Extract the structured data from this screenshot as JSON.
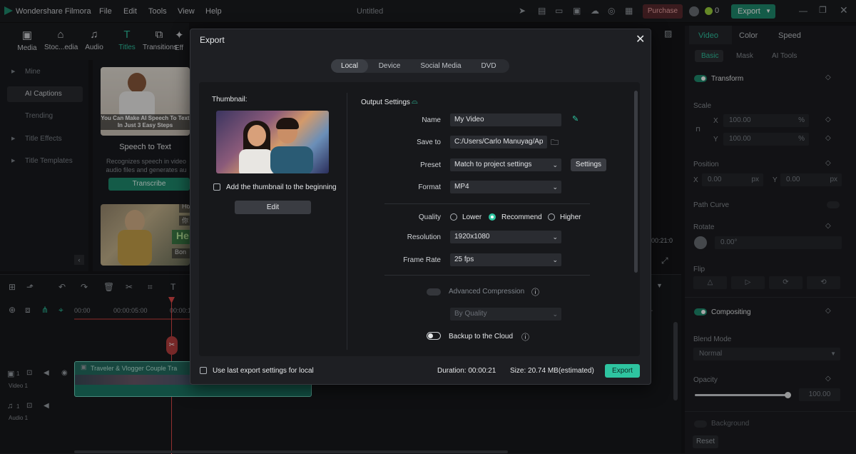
{
  "app": {
    "name": "Wondershare Filmora",
    "menu": [
      "File",
      "Edit",
      "Tools",
      "View",
      "Help"
    ],
    "project_title": "Untitled",
    "purchase": "Purchase",
    "credits": "0",
    "export": "Export"
  },
  "toolbar": [
    "Media",
    "Stoc...edia",
    "Audio",
    "Titles",
    "Transitions",
    "Eff"
  ],
  "left_nav": [
    "Mine",
    "AI Captions",
    "Trending",
    "Title Effects",
    "Title Templates"
  ],
  "content": {
    "card1_caption": "You Can Make AI Speech To Text In Just 3 Easy Steps",
    "card1_title": "Speech to Text",
    "card1_desc": "Recognizes speech in video audio files and generates au",
    "card1_button": "Transcribe",
    "card2_tags": [
      "Ho",
      "你",
      "He",
      "Bon"
    ]
  },
  "preview": {
    "timecode": "00:21:0"
  },
  "timeline": {
    "ruler": [
      "00:00",
      "00:00:05:00",
      "00:00:1"
    ],
    "clip_title": "Traveler & Vlogger Couple Tra",
    "track_video": "Video 1",
    "track_audio": "Audio 1",
    "track_video_num": "1",
    "track_audio_num": "1"
  },
  "right_panel": {
    "tabs": [
      "Video",
      "Color",
      "Speed"
    ],
    "subtabs": [
      "Basic",
      "Mask",
      "AI Tools"
    ],
    "transform": "Transform",
    "scale": "Scale",
    "scale_x": "100.00",
    "scale_y": "100.00",
    "pct": "%",
    "x_label": "X",
    "y_label": "Y",
    "px": "px",
    "position": "Position",
    "pos_x": "0.00",
    "pos_y": "0.00",
    "path_curve": "Path Curve",
    "rotate": "Rotate",
    "rotate_value": "0.00°",
    "flip": "Flip",
    "compositing": "Compositing",
    "blend_mode": "Blend Mode",
    "blend_value": "Normal",
    "opacity": "Opacity",
    "opacity_value": "100.00",
    "opacity_level": 1.0,
    "background": "Background",
    "reset": "Reset"
  },
  "export_dialog": {
    "title": "Export",
    "tabs": [
      "Local",
      "Device",
      "Social Media",
      "DVD"
    ],
    "active_tab": "Local",
    "thumbnail_label": "Thumbnail:",
    "add_thumbnail": "Add the thumbnail to the beginning",
    "edit": "Edit",
    "output_settings": "Output Settings",
    "name_label": "Name",
    "name_value": "My Video",
    "save_to_label": "Save to",
    "save_to_value": "C:/Users/Carlo Manuyag/Ap",
    "preset_label": "Preset",
    "preset_value": "Match to project settings",
    "settings_button": "Settings",
    "format_label": "Format",
    "format_value": "MP4",
    "quality_label": "Quality",
    "quality_options": [
      "Lower",
      "Recommend",
      "Higher"
    ],
    "quality_selected": "Recommend",
    "resolution_label": "Resolution",
    "resolution_value": "1920x1080",
    "frame_rate_label": "Frame Rate",
    "frame_rate_value": "25 fps",
    "advanced_compression": "Advanced Compression",
    "by_quality": "By Quality",
    "backup_cloud": "Backup to the Cloud",
    "use_last": "Use last export settings for local",
    "duration": "Duration: 00:00:21",
    "size": "Size: 20.74 MB(estimated)",
    "export_button": "Export"
  }
}
